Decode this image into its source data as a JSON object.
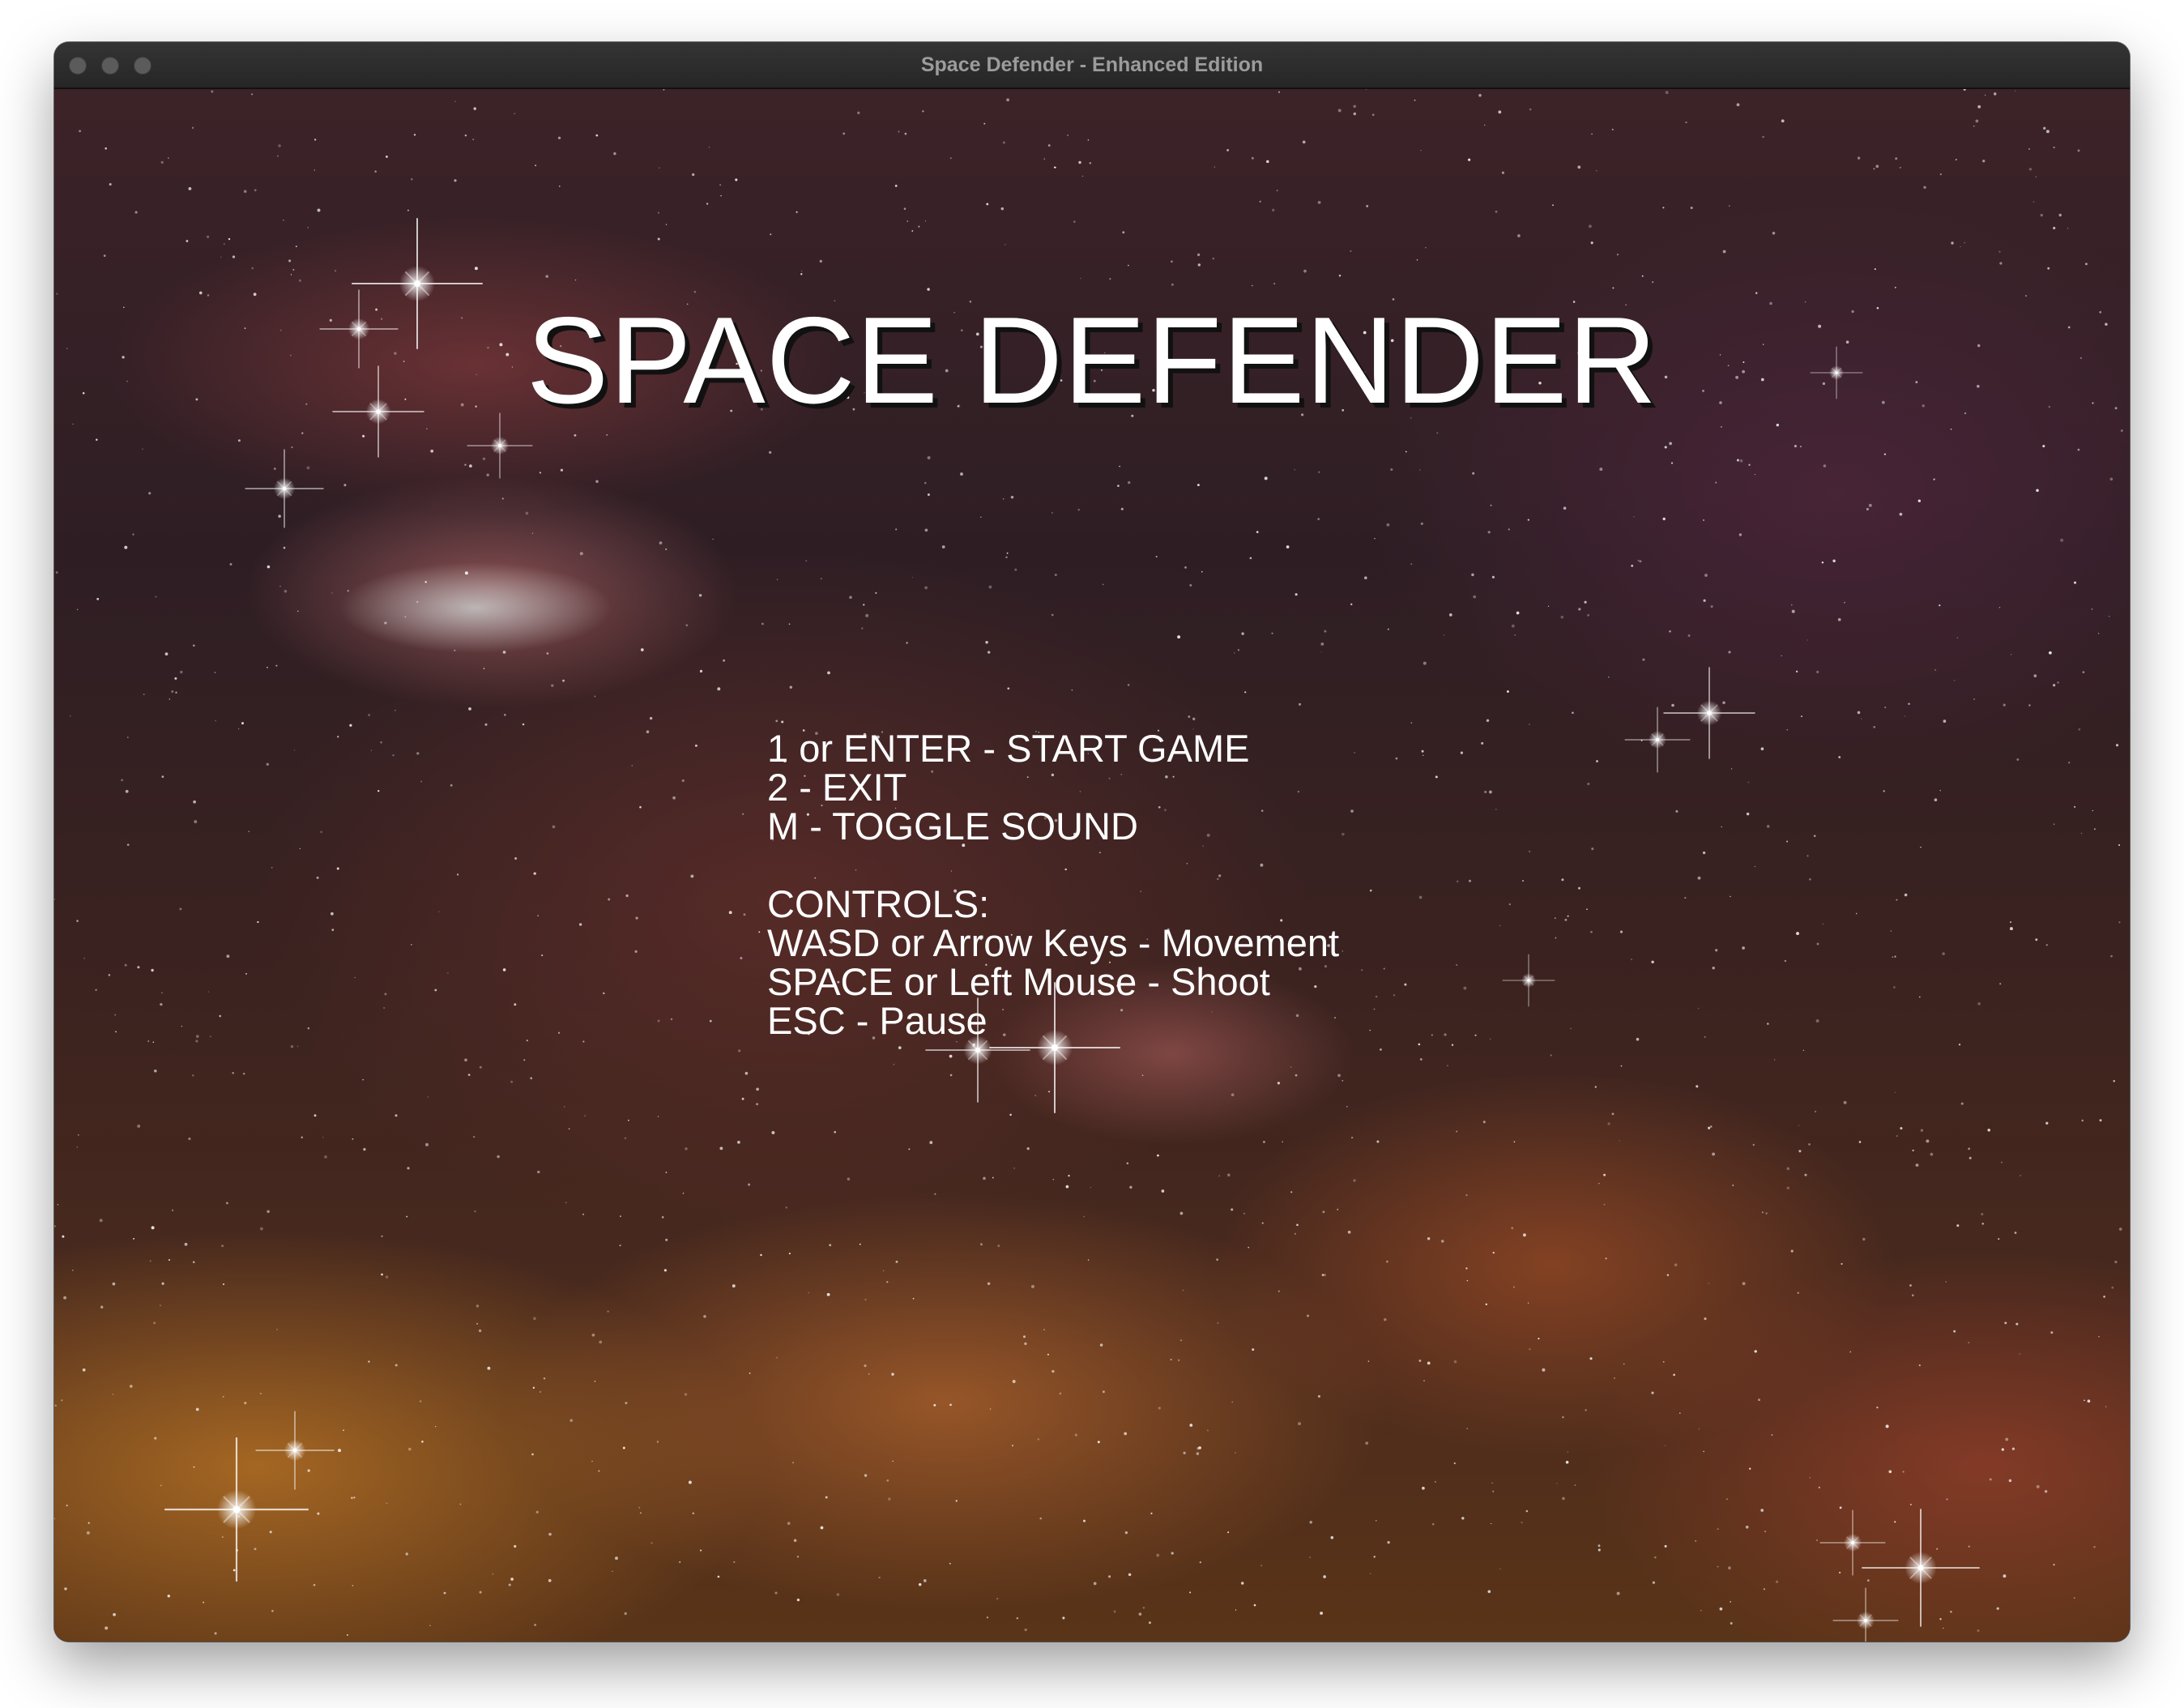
{
  "window": {
    "title": "Space Defender - Enhanced Edition"
  },
  "game": {
    "title": "SPACE DEFENDER",
    "menu_options": [
      "1 or ENTER - START GAME",
      "2 - EXIT",
      "M - TOGGLE SOUND"
    ],
    "controls_heading": "CONTROLS:",
    "controls": [
      "WASD or Arrow Keys - Movement",
      "SPACE or Left Mouse - Shoot",
      "ESC - Pause"
    ]
  },
  "colors": {
    "text": "#ffffff",
    "title_shadow": "#111111",
    "titlebar": "#2b2b2b",
    "nebula_red": "#aa4646",
    "nebula_orange": "#dc8c28"
  }
}
